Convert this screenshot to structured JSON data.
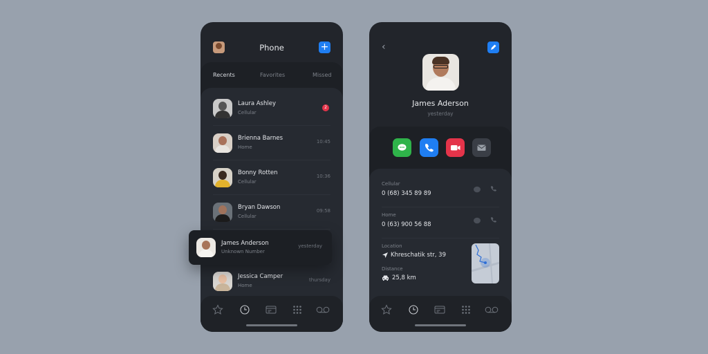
{
  "left": {
    "title": "Phone",
    "tabs": [
      "Recents",
      "Favorites",
      "Missed"
    ],
    "contacts": [
      {
        "name": "Laura Ashley",
        "type": "Cellular",
        "time": "",
        "badge": "2"
      },
      {
        "name": "Brienna Barnes",
        "type": "Home",
        "time": "10:45",
        "badge": ""
      },
      {
        "name": "Bonny Rotten",
        "type": "Cellular",
        "time": "10:36",
        "badge": ""
      },
      {
        "name": "Bryan Dawson",
        "type": "Cellular",
        "time": "09:58",
        "badge": ""
      },
      {
        "name": "Jessica Camper",
        "type": "Home",
        "time": "thursday",
        "badge": ""
      }
    ],
    "popup": {
      "name": "James Anderson",
      "type": "Unknown Number",
      "time": "yesterday"
    }
  },
  "right": {
    "name": "James Aderson",
    "date": "yesterday",
    "cellular_label": "Cellular",
    "cellular_value": "0 (68) 345 89 89",
    "home_label": "Home",
    "home_value": "0 (63) 900 56 88",
    "location_label": "Location",
    "location_value": "Khreschatik str, 39",
    "distance_label": "Distance",
    "distance_value": "25,8 km"
  },
  "colors": {
    "accent_blue": "#1f7ef2",
    "message_green": "#2fb34a",
    "video_red": "#e4344a",
    "badge_red": "#e4344a"
  },
  "icons": {
    "tabbar": [
      "star-icon",
      "clock-icon",
      "card-icon",
      "keypad-icon",
      "voicemail-icon"
    ],
    "actions": [
      "message-icon",
      "phone-icon",
      "video-icon",
      "mail-icon"
    ]
  }
}
